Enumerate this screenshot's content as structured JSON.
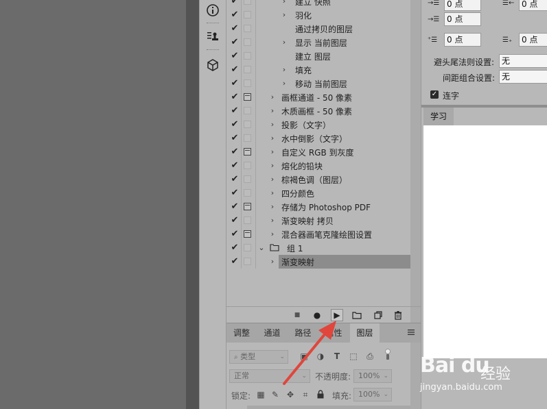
{
  "actions": {
    "rows": [
      {
        "check": "✔",
        "dialog": false,
        "indent": 2,
        "arrow": "›",
        "label": "建立 快照"
      },
      {
        "check": "✔",
        "dialog": false,
        "indent": 2,
        "arrow": "›",
        "label": "羽化"
      },
      {
        "check": "✔",
        "dialog": false,
        "indent": 2,
        "arrow": "",
        "label": "通过拷贝的图层"
      },
      {
        "check": "✔",
        "dialog": false,
        "indent": 2,
        "arrow": "›",
        "label": "显示 当前图层"
      },
      {
        "check": "✔",
        "dialog": false,
        "indent": 2,
        "arrow": "",
        "label": "建立 图层"
      },
      {
        "check": "✔",
        "dialog": false,
        "indent": 2,
        "arrow": "›",
        "label": "填充"
      },
      {
        "check": "✔",
        "dialog": false,
        "indent": 2,
        "arrow": "›",
        "label": "移动 当前图层"
      },
      {
        "check": "✔",
        "dialog": true,
        "indent": 1,
        "arrow": "›",
        "label": "画框通道 - 50 像素"
      },
      {
        "check": "✔",
        "dialog": false,
        "indent": 1,
        "arrow": "›",
        "label": "木质画框 - 50 像素"
      },
      {
        "check": "✔",
        "dialog": false,
        "indent": 1,
        "arrow": "›",
        "label": "投影（文字）"
      },
      {
        "check": "✔",
        "dialog": false,
        "indent": 1,
        "arrow": "›",
        "label": "水中倒影（文字）"
      },
      {
        "check": "✔",
        "dialog": true,
        "indent": 1,
        "arrow": "›",
        "label": "自定义 RGB 到灰度"
      },
      {
        "check": "✔",
        "dialog": false,
        "indent": 1,
        "arrow": "›",
        "label": "熔化的铅块"
      },
      {
        "check": "✔",
        "dialog": false,
        "indent": 1,
        "arrow": "›",
        "label": "棕褐色调（图层）"
      },
      {
        "check": "✔",
        "dialog": false,
        "indent": 1,
        "arrow": "›",
        "label": "四分颜色"
      },
      {
        "check": "✔",
        "dialog": true,
        "indent": 1,
        "arrow": "›",
        "label": "存储为 Photoshop PDF"
      },
      {
        "check": "✔",
        "dialog": false,
        "indent": 1,
        "arrow": "›",
        "label": "渐变映射 拷贝"
      },
      {
        "check": "✔",
        "dialog": true,
        "indent": 1,
        "arrow": "›",
        "label": "混合器画笔克隆绘图设置"
      },
      {
        "check": "✔",
        "dialog": false,
        "indent": 0,
        "arrow": "⌄",
        "label": "组 1",
        "folder": true
      },
      {
        "check": "✔",
        "dialog": false,
        "indent": 1,
        "arrow": "›",
        "label": "渐变映射",
        "selected": true
      }
    ]
  },
  "toolbar": {
    "stop_glyph": "■",
    "record_glyph": "●",
    "play_glyph": "▶"
  },
  "tabs": [
    {
      "label": "调整"
    },
    {
      "label": "通道"
    },
    {
      "label": "路径"
    },
    {
      "label": "属性"
    },
    {
      "label": "图层",
      "active": true
    }
  ],
  "layers": {
    "filter_placeholder": "类型",
    "blend_mode": "正常",
    "opacity_label": "不透明度:",
    "opacity_value": "100%",
    "lock_label": "锁定:",
    "fill_label": "填充:",
    "fill_value": "100%"
  },
  "paragraph": {
    "indent_left": "0 点",
    "indent_right": "0 点",
    "indent_first": "0 点",
    "space_before": "0 点",
    "space_after": "0 点",
    "kinsoku_label": "避头尾法则设置:",
    "kinsoku_value": "无",
    "mojikumi_label": "间距组合设置:",
    "mojikumi_value": "无",
    "hyphenate_label": "连字",
    "hyphenate_checked": true
  },
  "learn": {
    "tab_label": "学习"
  },
  "watermark": {
    "brand": "Bai du",
    "brand_cn": "经验",
    "url": "jingyan.baidu.com"
  },
  "colors": {
    "panel": "#b8b8b8",
    "canvas": "#6b6b6b",
    "arrow": "#e0463c"
  }
}
